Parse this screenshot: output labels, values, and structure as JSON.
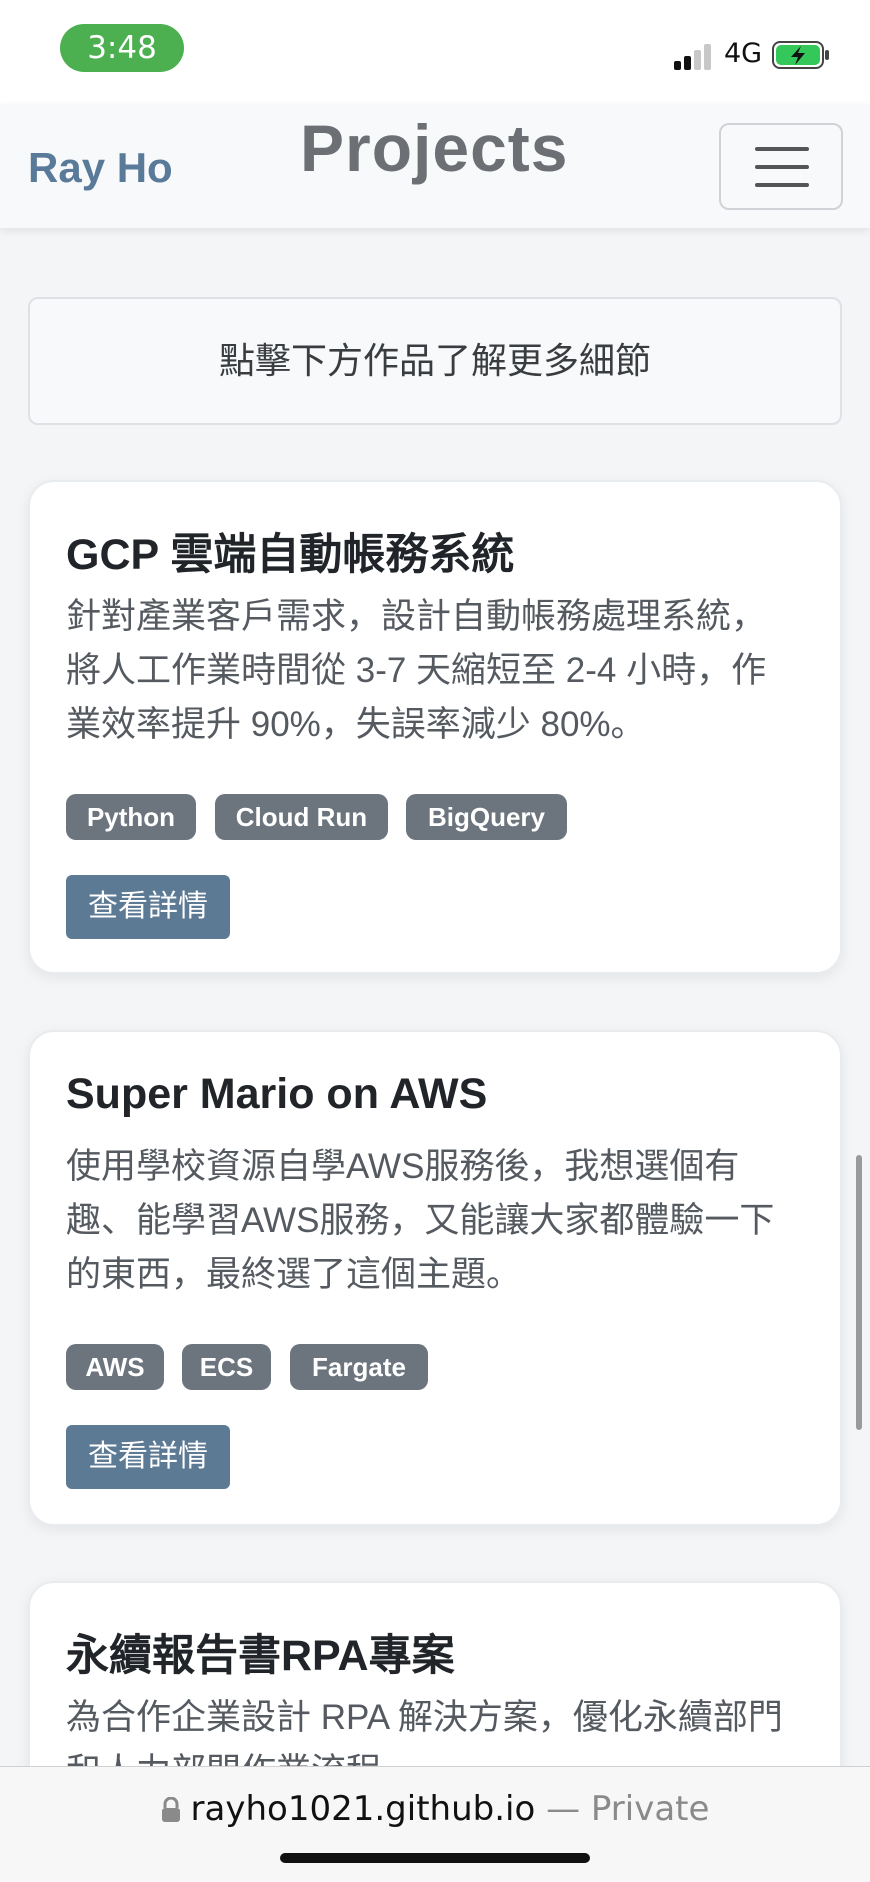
{
  "status_bar": {
    "time": "3:48",
    "network": "4G",
    "battery_color": "#34c759"
  },
  "navbar": {
    "brand": "Ray Ho",
    "title": "Projects",
    "menu_icon": "hamburger-icon"
  },
  "intro": {
    "text": "點擊下方作品了解更多細節"
  },
  "projects": [
    {
      "title": "GCP 雲端自動帳務系統",
      "desc_lines": [
        "針對產業客戶需求，設計自動帳務處理系統，",
        "將人工作業時間從 3-7 天縮短至 2-4 小時，作",
        "業效率提升 90%，失誤率減少 80%。"
      ],
      "tags": [
        "Python",
        "Cloud Run",
        "BigQuery"
      ],
      "button": "查看詳情"
    },
    {
      "title": "Super Mario on AWS",
      "desc_lines": [
        "使用學校資源自學AWS服務後，我想選個有",
        "趣、能學習AWS服務，又能讓大家都體驗一下",
        "的東西，最終選了這個主題。"
      ],
      "tags": [
        "AWS",
        "ECS",
        "Fargate"
      ],
      "button": "查看詳情"
    },
    {
      "title": "永續報告書RPA專案",
      "desc_lines": [
        "為合作企業設計 RPA 解決方案，優化永續部門",
        "和人力部門作業流程"
      ]
    }
  ],
  "browser": {
    "url": "rayho1021.github.io",
    "separator": "—",
    "mode": "Private",
    "lock_icon": "lock-icon"
  },
  "colors": {
    "brand": "#5a7a99",
    "tag_bg": "#6c757d",
    "button_bg": "#5d7a94"
  }
}
